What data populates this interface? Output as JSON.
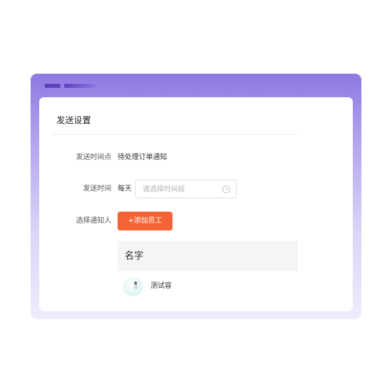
{
  "page_title": "发送设置",
  "form": {
    "send_time_point": {
      "label": "发送时间点",
      "value": "待处理订单通知"
    },
    "send_time": {
      "label": "发送时间",
      "prefix": "每天",
      "placeholder": "请选择时间段"
    },
    "notify_person": {
      "label": "选择通知人",
      "add_button": "+添加员工"
    }
  },
  "members_table": {
    "header": "名字",
    "rows": [
      {
        "name": "测试容"
      }
    ]
  },
  "colors": {
    "accent": "#f46335",
    "window_gradient_top": "#8f78e2",
    "window_gradient_bottom": "#efecfc",
    "titlebar_bars": "#5d3fc4"
  },
  "icons": {
    "time_input": "clock-icon",
    "member_avatar": "avatar"
  }
}
